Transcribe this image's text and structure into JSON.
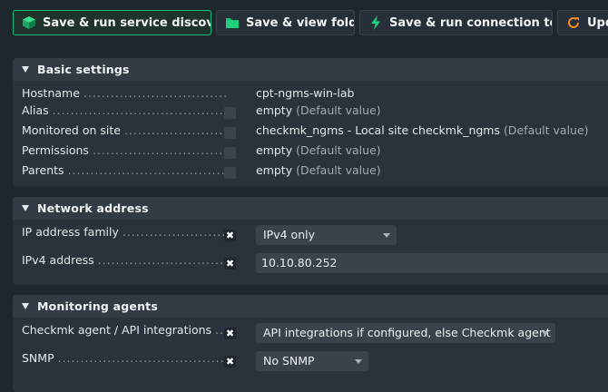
{
  "toolbar": {
    "buttons": [
      {
        "label": "Save & run service discovery",
        "icon": "discovery-cube-icon"
      },
      {
        "label": "Save & view folder",
        "icon": "folder-icon"
      },
      {
        "label": "Save & run connection tests",
        "icon": "lightning-icon"
      },
      {
        "label": "Upda",
        "icon": "refresh-icon"
      }
    ]
  },
  "sections": {
    "basic": {
      "title": "Basic settings",
      "hostname": {
        "label": "Hostname",
        "value": "cpt-ngms-win-lab"
      },
      "alias": {
        "label": "Alias",
        "value": "empty",
        "default": "(Default value)"
      },
      "site": {
        "label": "Monitored on site",
        "value": "checkmk_ngms - Local site checkmk_ngms",
        "default": "(Default value)"
      },
      "permissions": {
        "label": "Permissions",
        "value": "empty",
        "default": "(Default value)"
      },
      "parents": {
        "label": "Parents",
        "value": "empty",
        "default": "(Default value)"
      }
    },
    "network": {
      "title": "Network address",
      "ip_family": {
        "label": "IP address family",
        "value": "IPv4 only"
      },
      "ipv4": {
        "label": "IPv4 address",
        "value": "10.10.80.252"
      }
    },
    "agents": {
      "title": "Monitoring agents",
      "checkmk_agent": {
        "label": "Checkmk agent / API integrations",
        "value": "API integrations if configured, else Checkmk agent"
      },
      "snmp": {
        "label": "SNMP",
        "value": "No SNMP"
      }
    }
  },
  "checkbox_mark": "✖",
  "dots": "..............................................................",
  "colors": {
    "background": "#1e262e",
    "panel": "#2a323b",
    "accent_green": "#15bd77",
    "refresh_orange": "#f08a24"
  }
}
